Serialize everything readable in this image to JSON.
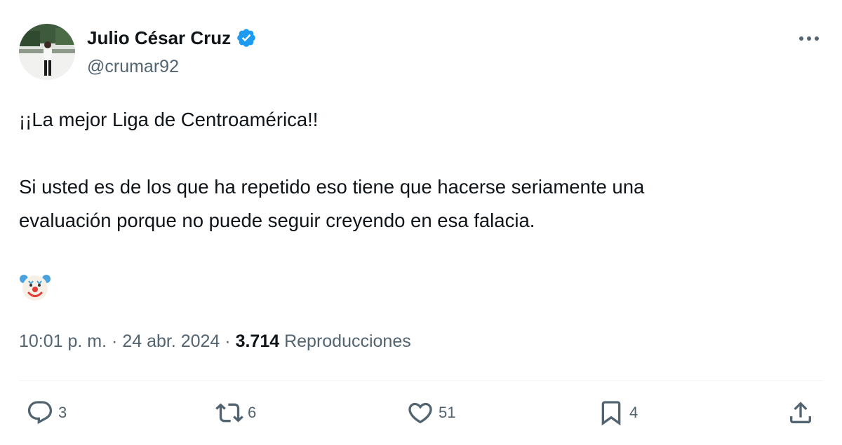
{
  "author": {
    "name": "Julio César Cruz",
    "handle": "@crumar92",
    "verified_color": "#1d9bf0",
    "avatar_icon": "person-photo"
  },
  "tweet": {
    "line1": "¡¡La mejor Liga de Centroamérica!!",
    "line2": "Si usted es de los que ha repetido eso tiene que hacerse seriamente una",
    "line3": "evaluación porque no puede seguir creyendo en esa falacia.",
    "emoji": "clown-face-emoji"
  },
  "meta": {
    "time": "10:01 p. m.",
    "separator": "·",
    "date": "24 abr. 2024",
    "views": "3.714",
    "views_label": "Reproducciones"
  },
  "actions": {
    "replies": "3",
    "retweets": "6",
    "likes": "51",
    "bookmarks": "4"
  },
  "colors": {
    "text": "#0f1419",
    "secondary": "#536471",
    "accent": "#1d9bf0",
    "divider": "#eff3f4"
  }
}
